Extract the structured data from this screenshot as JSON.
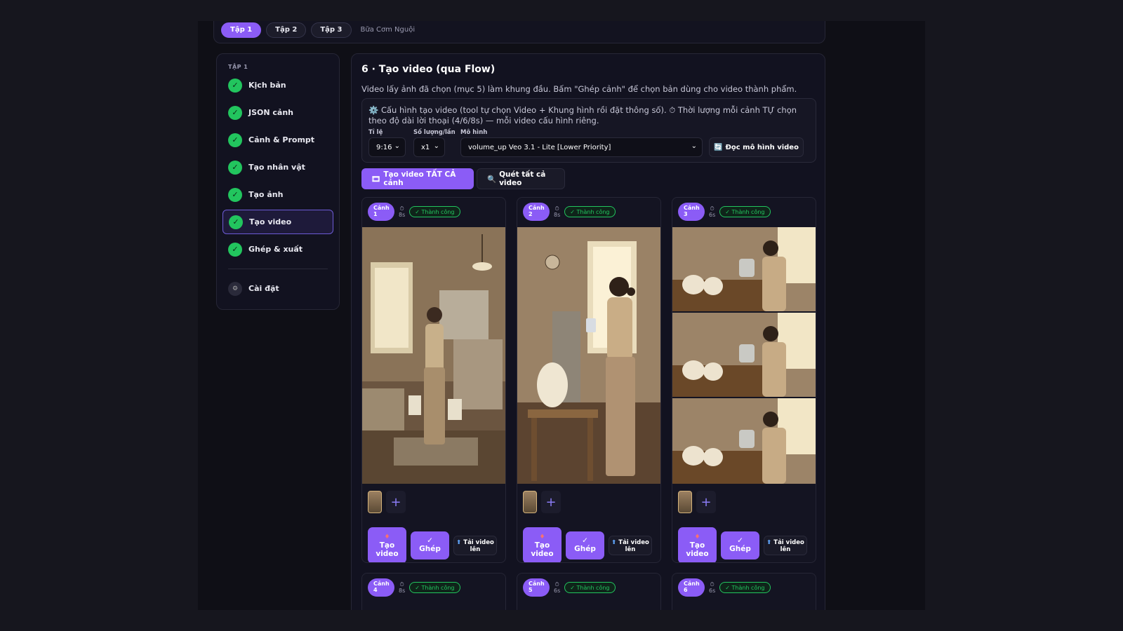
{
  "tabs": [
    {
      "label": "Tập 1",
      "active": true
    },
    {
      "label": "Tập 2",
      "active": false
    },
    {
      "label": "Tập 3",
      "active": false
    }
  ],
  "breadcrumb": "Bữa Cơm Nguội",
  "sidebar": {
    "heading": "TẬP 1",
    "items": [
      {
        "label": "Kịch bản",
        "status": "done"
      },
      {
        "label": "JSON cảnh",
        "status": "done"
      },
      {
        "label": "Cảnh & Prompt",
        "status": "done"
      },
      {
        "label": "Tạo nhân vật",
        "status": "done"
      },
      {
        "label": "Tạo ảnh",
        "status": "done"
      },
      {
        "label": "Tạo video",
        "status": "done",
        "active": true
      },
      {
        "label": "Ghép & xuất",
        "status": "done"
      }
    ],
    "settings_label": "Cài đặt",
    "check_glyph": "✓",
    "gear_glyph": "⚙"
  },
  "main": {
    "title": "6 · Tạo video (qua Flow)",
    "description": "Video lấy ảnh đã chọn (mục 5) làm khung đầu. Bấm \"Ghép cảnh\" để chọn bản dùng cho video thành phẩm.",
    "config_note": "⚙️ Cấu hình tạo video (tool tự chọn Video + Khung hình rồi đặt thông số). ⏱ Thời lượng mỗi cảnh TỰ chọn theo độ dài lời thoại (4/6/8s) — mỗi video cấu hình riêng.",
    "ratio_label": "Tỉ lệ",
    "ratio_value": "9:16",
    "count_label": "Số lượng/lần",
    "count_value": "x1",
    "model_label": "Mô hình",
    "model_value": "volume_up Veo 3.1 - Lite [Lower Priority]",
    "read_models_label": "Đọc mô hình video",
    "generate_all_label": "Tạo video TẤT CẢ cảnh",
    "scan_all_label": "Quét tất cả video"
  },
  "scenes": [
    {
      "label": "Cảnh 1",
      "num": "1",
      "duration": "8s",
      "status": "✓ Thành công"
    },
    {
      "label": "Cảnh 2",
      "num": "2",
      "duration": "8s",
      "status": "✓ Thành công"
    },
    {
      "label": "Cảnh 3",
      "num": "3",
      "duration": "6s",
      "status": "✓ Thành công"
    },
    {
      "label": "Cảnh 4",
      "num": "4",
      "duration": "8s",
      "status": "✓ Thành công"
    },
    {
      "label": "Cảnh 5",
      "num": "5",
      "duration": "6s",
      "status": "✓ Thành công"
    },
    {
      "label": "Cảnh 6",
      "num": "6",
      "duration": "6s",
      "status": "✓ Thành công"
    }
  ],
  "card_buttons": {
    "generate": "Tạo video",
    "merge": "Ghép",
    "upload": "Tải video lên"
  },
  "colors": {
    "accent": "#8b5cf6",
    "success": "#22c55e",
    "bg": "#0f0f16",
    "panel": "#121220"
  }
}
